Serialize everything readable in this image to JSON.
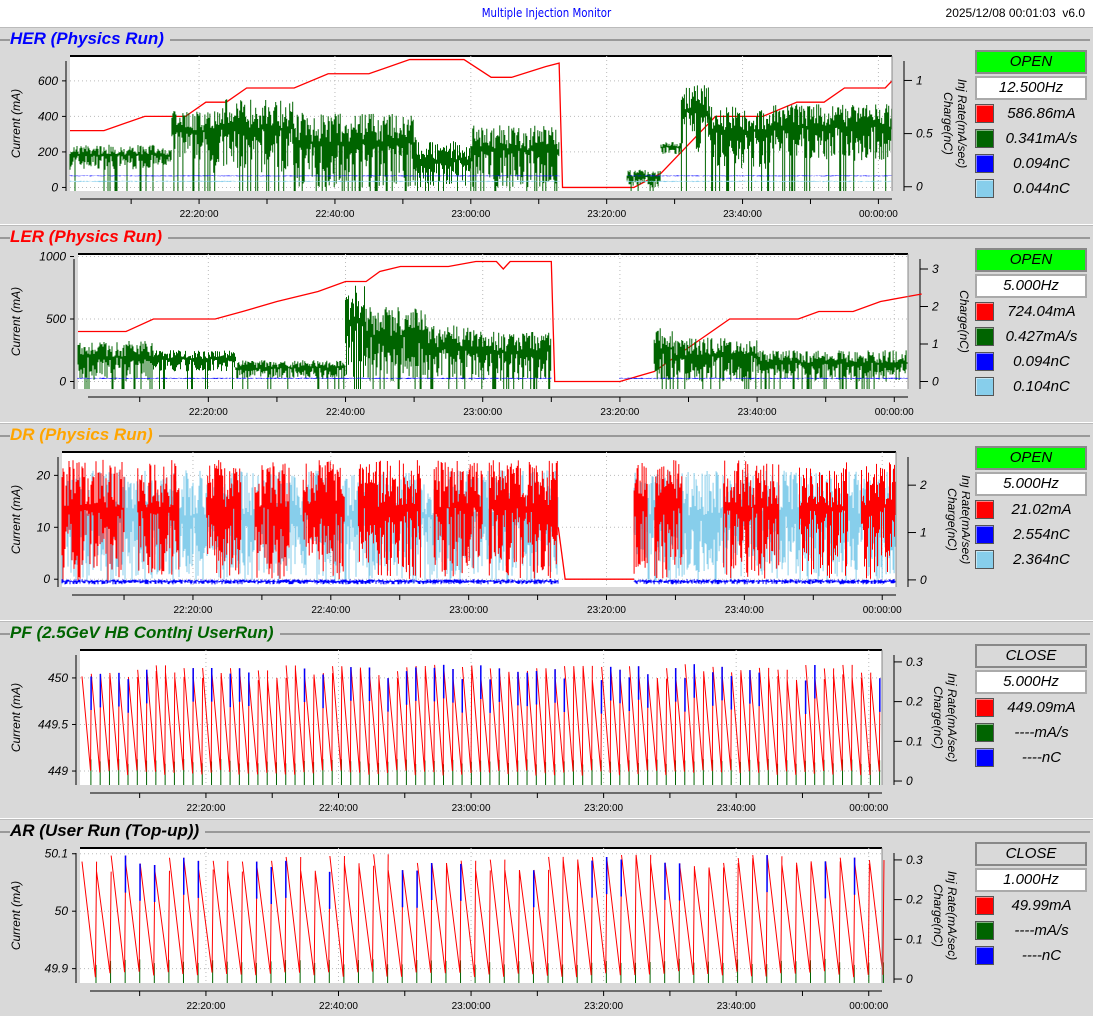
{
  "header": {
    "title": "Multiple Injection Monitor",
    "timestamp": "2025/12/08 00:01:03",
    "version": "v6.0"
  },
  "colors": {
    "current": "#ff0000",
    "inj_rate": "#006400",
    "charge1": "#0000ff",
    "charge2": "#87ceeb",
    "open": "#00ff00",
    "close": "#d9d9d9"
  },
  "xaxis": {
    "tmin_minutes_after_22h": 1,
    "tmax_minutes_after_22h": 122,
    "ticks": [
      {
        "t": 20,
        "label": "22:20:00"
      },
      {
        "t": 40,
        "label": "22:40:00"
      },
      {
        "t": 60,
        "label": "23:00:00"
      },
      {
        "t": 80,
        "label": "23:20:00"
      },
      {
        "t": 100,
        "label": "23:40:00"
      },
      {
        "t": 120,
        "label": "00:00:00"
      }
    ]
  },
  "panels": [
    {
      "id": "her",
      "title": "HER  (Physics Run)",
      "title_color": "#0000ff",
      "ylabel": "Current (mA)",
      "y2label1": "Charge(nC)",
      "y2label2": "Inj Rate(mA/sec)",
      "ylim": [
        -20,
        740
      ],
      "yticks": [
        {
          "v": 0,
          "l": "0"
        },
        {
          "v": 200,
          "l": "200"
        },
        {
          "v": 400,
          "l": "400"
        },
        {
          "v": 600,
          "l": "600"
        }
      ],
      "y2lim": [
        -0.04,
        1.23
      ],
      "y2ticks": [
        {
          "v": 0,
          "l": "0"
        },
        {
          "v": 0.5,
          "l": "0.5"
        },
        {
          "v": 1,
          "l": "1"
        }
      ],
      "status": "OPEN",
      "frequency": "12.500Hz",
      "legend": [
        {
          "color": "#ff0000",
          "value": "586.86mA"
        },
        {
          "color": "#006400",
          "value": "0.341mA/s"
        },
        {
          "color": "#0000ff",
          "value": "0.094nC"
        },
        {
          "color": "#87ceeb",
          "value": "0.044nC"
        }
      ],
      "chart_data": {
        "type": "line",
        "series": [
          {
            "name": "current",
            "color": "#ff0000",
            "points": [
              [
                1,
                320
              ],
              [
                6,
                320
              ],
              [
                12,
                400
              ],
              [
                18,
                400
              ],
              [
                21,
                480
              ],
              [
                24,
                480
              ],
              [
                27,
                560
              ],
              [
                34,
                560
              ],
              [
                39,
                640
              ],
              [
                45,
                640
              ],
              [
                51,
                720
              ],
              [
                59,
                720
              ],
              [
                63,
                620
              ],
              [
                66,
                620
              ],
              [
                71,
                680
              ],
              [
                73,
                700
              ],
              [
                73.5,
                0
              ],
              [
                84,
                0
              ],
              [
                88,
                80
              ],
              [
                96,
                400
              ],
              [
                103,
                400
              ],
              [
                108,
                480
              ],
              [
                112,
                480
              ],
              [
                115,
                560
              ],
              [
                121,
                560
              ],
              [
                122,
                600
              ]
            ]
          },
          {
            "name": "inj_rate",
            "color": "#006400",
            "bands": [
              [
                1,
                15,
                100,
                240
              ],
              [
                15,
                16,
                120,
                220
              ],
              [
                16,
                22,
                150,
                430
              ],
              [
                22,
                34,
                80,
                500
              ],
              [
                34,
                52,
                0,
                420
              ],
              [
                52,
                60,
                0,
                260
              ],
              [
                60,
                73,
                0,
                350
              ],
              [
                83,
                88,
                0,
                100
              ],
              [
                88,
                91,
                180,
                260
              ],
              [
                91,
                95,
                200,
                580
              ],
              [
                95,
                104,
                100,
                460
              ],
              [
                104,
                122,
                150,
                470
              ]
            ]
          },
          {
            "name": "charge_1",
            "color": "#0000ff",
            "bands": [
              [
                1,
                73,
                62,
                68
              ],
              [
                83,
                122,
                62,
                68
              ]
            ]
          },
          {
            "name": "charge_2",
            "color": "#87ceeb",
            "bands": [
              [
                1,
                73,
                30,
                38
              ],
              [
                83,
                122,
                30,
                38
              ]
            ]
          }
        ]
      }
    },
    {
      "id": "ler",
      "title": "LER  (Physics Run)",
      "title_color": "#ff0000",
      "ylabel": "Current (mA)",
      "y2label1": "Charge(nC)",
      "y2label2": "Inj Rate(mA/sec)",
      "ylim": [
        -60,
        1020
      ],
      "yticks": [
        {
          "v": 0,
          "l": "0"
        },
        {
          "v": 500,
          "l": "500"
        },
        {
          "v": 1000,
          "l": "1000"
        }
      ],
      "y2lim": [
        -0.2,
        3.4
      ],
      "y2ticks": [
        {
          "v": 0,
          "l": "0"
        },
        {
          "v": 1,
          "l": "1"
        },
        {
          "v": 2,
          "l": "2"
        },
        {
          "v": 3,
          "l": "3"
        }
      ],
      "status": "OPEN",
      "frequency": "5.000Hz",
      "legend": [
        {
          "color": "#ff0000",
          "value": "724.04mA"
        },
        {
          "color": "#006400",
          "value": "0.427mA/s"
        },
        {
          "color": "#0000ff",
          "value": "0.094nC"
        },
        {
          "color": "#87ceeb",
          "value": "0.104nC"
        }
      ],
      "chart_data": {
        "type": "line",
        "series": [
          {
            "name": "current",
            "color": "#ff0000",
            "points": [
              [
                1,
                400
              ],
              [
                8,
                400
              ],
              [
                12,
                500
              ],
              [
                21,
                500
              ],
              [
                25,
                560
              ],
              [
                30,
                640
              ],
              [
                36,
                720
              ],
              [
                40,
                800
              ],
              [
                43,
                800
              ],
              [
                45,
                880
              ],
              [
                48,
                920
              ],
              [
                55,
                920
              ],
              [
                59,
                960
              ],
              [
                62,
                960
              ],
              [
                63,
                900
              ],
              [
                64,
                960
              ],
              [
                70,
                960
              ],
              [
                70.5,
                0
              ],
              [
                80,
                0
              ],
              [
                85,
                80
              ],
              [
                96,
                500
              ],
              [
                106,
                500
              ],
              [
                109,
                560
              ],
              [
                114,
                560
              ],
              [
                118,
                640
              ],
              [
                124,
                700
              ]
            ]
          },
          {
            "name": "inj_rate",
            "color": "#006400",
            "bands": [
              [
                1,
                12,
                0,
                330
              ],
              [
                12,
                24,
                80,
                250
              ],
              [
                24,
                40,
                20,
                170
              ],
              [
                40,
                43,
                0,
                780
              ],
              [
                43,
                52,
                0,
                600
              ],
              [
                52,
                60,
                0,
                450
              ],
              [
                60,
                70,
                0,
                400
              ],
              [
                85,
                88,
                0,
                440
              ],
              [
                88,
                100,
                0,
                350
              ],
              [
                100,
                122,
                0,
                250
              ]
            ]
          },
          {
            "name": "charge_1",
            "color": "#0000ff",
            "bands": [
              [
                1,
                70,
                20,
                30
              ],
              [
                80,
                122,
                20,
                30
              ]
            ]
          }
        ]
      }
    },
    {
      "id": "dr",
      "title": "DR  (Physics Run)",
      "title_color": "#ffa500",
      "ylabel": "Current (mA)",
      "y2label1": "Charge(nC)",
      "y2label2": "Inj Rate(mA/sec)",
      "ylim": [
        -1.5,
        24.5
      ],
      "yticks": [
        {
          "v": 0,
          "l": "0"
        },
        {
          "v": 10,
          "l": "10"
        },
        {
          "v": 20,
          "l": "20"
        }
      ],
      "y2lim": [
        -0.15,
        2.7
      ],
      "y2ticks": [
        {
          "v": 0,
          "l": "0"
        },
        {
          "v": 1,
          "l": "1"
        },
        {
          "v": 2,
          "l": "2"
        }
      ],
      "status": "OPEN",
      "frequency": "5.000Hz",
      "legend": [
        {
          "color": "#ff0000",
          "value": "21.02mA"
        },
        {
          "color": "#0000ff",
          "value": "2.554nC"
        },
        {
          "color": "#87ceeb",
          "value": "2.364nC"
        }
      ],
      "chart_data": {
        "type": "line",
        "series": [
          {
            "name": "charge_2",
            "color": "#87ceeb",
            "bands": [
              [
                1,
                73,
                -1,
                21
              ],
              [
                84,
                122,
                -1,
                21
              ]
            ]
          },
          {
            "name": "current",
            "color": "#ff0000",
            "bands": [
              [
                1,
                10,
                -1,
                23
              ],
              [
                12,
                18,
                0,
                23
              ],
              [
                22,
                27,
                0,
                23
              ],
              [
                29,
                34,
                0,
                23
              ],
              [
                36,
                42,
                0,
                23
              ],
              [
                44,
                53,
                0,
                23
              ],
              [
                55,
                62,
                0,
                23
              ],
              [
                63,
                73,
                0,
                23
              ],
              [
                84,
                86,
                0,
                23
              ],
              [
                87,
                91,
                0,
                23
              ],
              [
                97,
                105,
                0,
                23
              ],
              [
                108,
                115,
                0,
                23
              ],
              [
                117,
                122,
                0,
                23
              ]
            ]
          },
          {
            "name": "charge_1",
            "color": "#0000ff",
            "bands": [
              [
                1,
                73,
                -1,
                0
              ],
              [
                84,
                122,
                -1,
                0
              ]
            ]
          },
          {
            "name": "current_line",
            "color": "#ff0000",
            "points": [
              [
                73,
                10
              ],
              [
                74,
                0
              ],
              [
                84,
                0
              ]
            ]
          }
        ]
      }
    },
    {
      "id": "pf",
      "title": "PF  (2.5GeV HB ContInj UserRun)",
      "title_color": "#006400",
      "ylabel": "Current (mA)",
      "y2label1": "Charge(nC)",
      "y2label2": "Inj Rate(mA/sec)",
      "ylim": [
        448.85,
        450.3
      ],
      "yticks": [
        {
          "v": 449,
          "l": "449"
        },
        {
          "v": 449.5,
          "l": "449.5"
        },
        {
          "v": 450,
          "l": "450"
        }
      ],
      "y2lim": [
        -0.01,
        0.33
      ],
      "y2ticks": [
        {
          "v": 0,
          "l": "0"
        },
        {
          "v": 0.1,
          "l": "0.1"
        },
        {
          "v": 0.2,
          "l": "0.2"
        },
        {
          "v": 0.3,
          "l": "0.3"
        }
      ],
      "status": "CLOSE",
      "frequency": "5.000Hz",
      "legend": [
        {
          "color": "#ff0000",
          "value": "449.09mA"
        },
        {
          "color": "#006400",
          "value": "----mA/s"
        },
        {
          "color": "#0000ff",
          "value": "----nC"
        }
      ],
      "chart_data": {
        "type": "line",
        "sawtooth": {
          "period_min": 1.4,
          "lo": 448.95,
          "hi": 450.15
        }
      }
    },
    {
      "id": "ar",
      "title": "AR  (User Run (Top-up))",
      "title_color": "#000000",
      "ylabel": "Current (mA)",
      "y2label1": "Charge(nC)",
      "y2label2": "Inj Rate(mA/sec)",
      "ylim": [
        49.875,
        50.11
      ],
      "yticks": [
        {
          "v": 49.9,
          "l": "49.9"
        },
        {
          "v": 50,
          "l": "50"
        },
        {
          "v": 50.1,
          "l": "50.1"
        }
      ],
      "y2lim": [
        -0.01,
        0.33
      ],
      "y2ticks": [
        {
          "v": 0,
          "l": "0"
        },
        {
          "v": 0.1,
          "l": "0.1"
        },
        {
          "v": 0.2,
          "l": "0.2"
        },
        {
          "v": 0.3,
          "l": "0.3"
        }
      ],
      "status": "CLOSE",
      "frequency": "1.000Hz",
      "legend": [
        {
          "color": "#ff0000",
          "value": "49.99mA"
        },
        {
          "color": "#006400",
          "value": "----mA/s"
        },
        {
          "color": "#0000ff",
          "value": "----nC"
        }
      ],
      "chart_data": {
        "type": "line",
        "sawtooth": {
          "period_min": 2.2,
          "lo": 49.885,
          "hi": 50.1
        }
      }
    }
  ]
}
